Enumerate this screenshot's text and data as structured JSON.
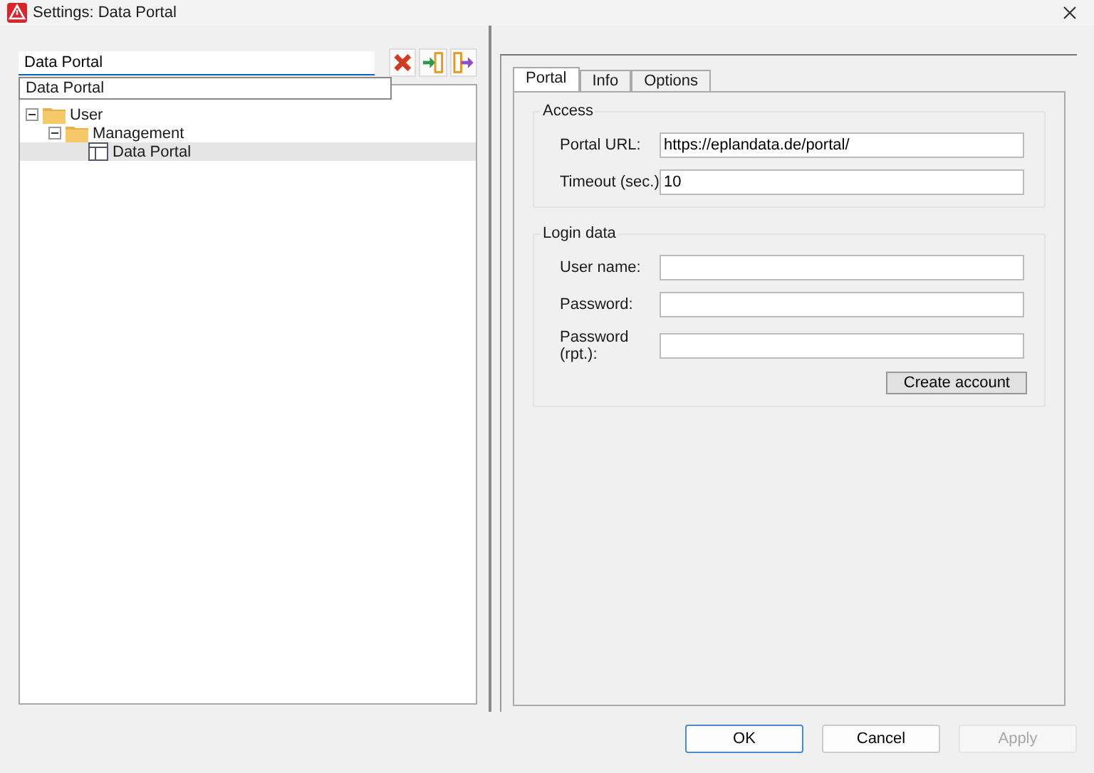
{
  "window": {
    "title": "Settings: Data Portal"
  },
  "search": {
    "value": "Data Portal"
  },
  "suggestions": [
    "Data Portal"
  ],
  "tree": [
    {
      "label": "User",
      "kind": "folder",
      "expanded": true,
      "selected": false,
      "children": [
        {
          "label": "Management",
          "kind": "folder",
          "expanded": true,
          "selected": false,
          "children": [
            {
              "label": "Data Portal",
              "kind": "page",
              "selected": true
            }
          ]
        }
      ]
    }
  ],
  "tabs": [
    {
      "label": "Portal",
      "selected": true
    },
    {
      "label": "Info",
      "selected": false
    },
    {
      "label": "Options",
      "selected": false
    }
  ],
  "groups": [
    {
      "title": "Access",
      "fields": [
        {
          "label": "Portal URL:",
          "value": "https://eplandata.de/portal/"
        },
        {
          "label": "Timeout (sec.)",
          "value": "10"
        }
      ]
    },
    {
      "title": "Login data",
      "fields": [
        {
          "label": "User name:"
        },
        {
          "label": "Password:"
        },
        {
          "label": "Password (rpt.):"
        }
      ],
      "button": "Create account"
    }
  ],
  "buttons": [
    {
      "label": "OK",
      "default": true,
      "disabled": false
    },
    {
      "label": "Cancel",
      "default": false,
      "disabled": false
    },
    {
      "label": "Apply",
      "default": false,
      "disabled": true
    }
  ]
}
